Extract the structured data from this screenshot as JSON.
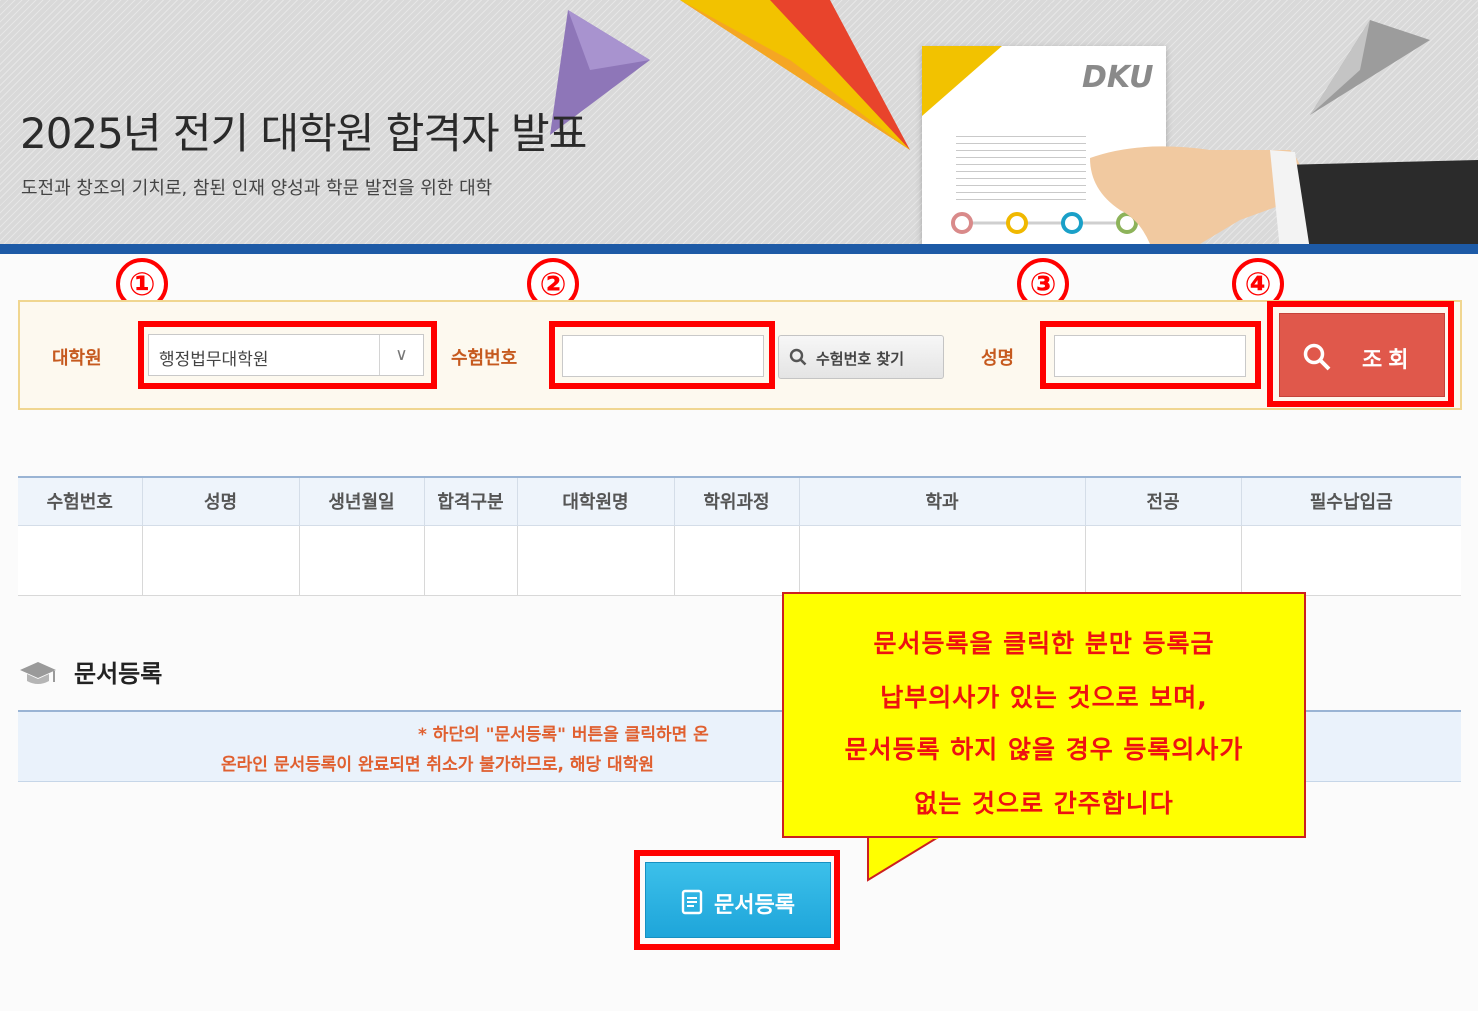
{
  "banner": {
    "title": "2025년 전기 대학원 합격자 발표",
    "subtitle": "도전과 창조의 기치로, 참된 인재 양성과 학문 발전을 위한 대학",
    "logo_text": "DKU"
  },
  "markers": [
    "①",
    "②",
    "③",
    "④"
  ],
  "search": {
    "graduate_school_label": "대학원",
    "graduate_school_value": "행정법무대학원",
    "exam_number_label": "수험번호",
    "exam_number_value": "",
    "find_exam_number_button": "수험번호 찾기",
    "name_label": "성명",
    "name_value": "",
    "query_button": "조회"
  },
  "results": {
    "columns": [
      "수험번호",
      "성명",
      "생년월일",
      "합격구분",
      "대학원명",
      "학위과정",
      "학과",
      "전공",
      "필수납입금"
    ],
    "rows": []
  },
  "documents": {
    "title": "문서등록",
    "notice_line1": "* 하단의 \"문서등록\" 버튼을 클릭하면 온",
    "notice_line2": "온라인 문서등록이 완료되면 취소가 불가하므로, 해당 대학원",
    "register_button": "문서등록"
  },
  "callout": {
    "lines": [
      "문서등록을 클릭한 분만 등록금",
      "납부의사가 있는 것으로 보며,",
      "문서등록 하지 않을 경우 등록의사가",
      "없는 것으로 간주합니다"
    ]
  },
  "colors": {
    "accent_blue": "#1d5aa6",
    "query_red": "#e0584b",
    "doc_button_blue": "#1ea5da",
    "highlight_red": "#ff0000",
    "callout_yellow": "#ffff00"
  }
}
